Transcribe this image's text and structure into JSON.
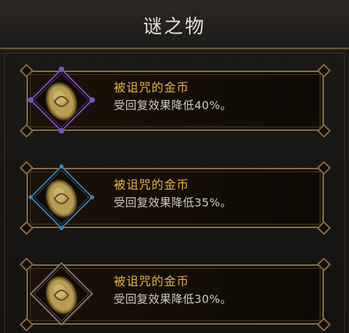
{
  "header": {
    "title": "谜之物"
  },
  "items": [
    {
      "name": "被诅咒的金币",
      "desc": "受回复效果降低40%。",
      "frame_color": "#7a4fc0",
      "rarity": "purple"
    },
    {
      "name": "被诅咒的金币",
      "desc": "受回复效果降低35%。",
      "frame_color": "#3c7fb5",
      "rarity": "blue"
    },
    {
      "name": "被诅咒的金币",
      "desc": "受回复效果降低30%。",
      "frame_color": "#7f7a72",
      "rarity": "gray"
    }
  ],
  "icons": {
    "item_icon": "cursed-gold-coin-icon"
  }
}
